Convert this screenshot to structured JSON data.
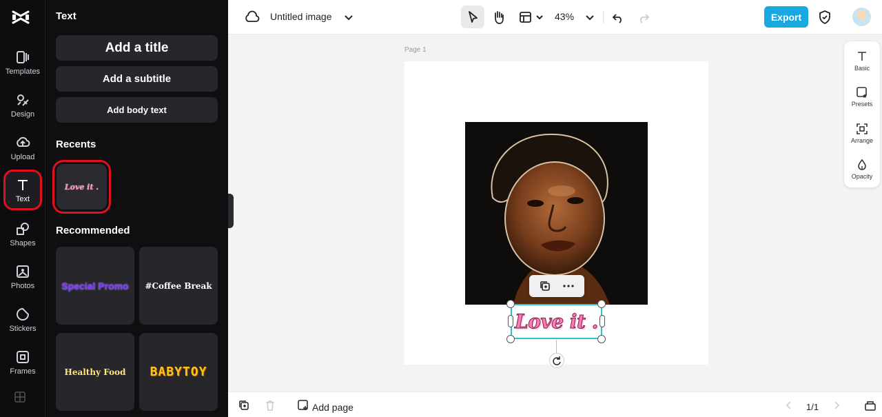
{
  "rail": {
    "items": [
      {
        "label": "Templates",
        "icon": "templates-icon"
      },
      {
        "label": "Design",
        "icon": "design-icon"
      },
      {
        "label": "Upload",
        "icon": "upload-icon"
      },
      {
        "label": "Text",
        "icon": "text-icon",
        "active": true
      },
      {
        "label": "Shapes",
        "icon": "shapes-icon"
      },
      {
        "label": "Photos",
        "icon": "photos-icon"
      },
      {
        "label": "Stickers",
        "icon": "stickers-icon"
      },
      {
        "label": "Frames",
        "icon": "frames-icon"
      }
    ]
  },
  "panel": {
    "title": "Text",
    "add_title": "Add a title",
    "add_subtitle": "Add a subtitle",
    "add_body": "Add body text",
    "recents_title": "Recents",
    "recent_item": "Love it .",
    "recommended_title": "Recommended",
    "recommended": [
      {
        "text": "Special Promo",
        "color": "#7b3cff"
      },
      {
        "text": "#Coffee Break",
        "color": "#ffffff"
      },
      {
        "text": "Healthy Food",
        "color": "#ffe57a"
      },
      {
        "text": "BABYTOY",
        "color": "#ffc21a"
      }
    ]
  },
  "topbar": {
    "doc_title": "Untitled image",
    "zoom": "43%",
    "export_label": "Export",
    "accent_color": "#1aa8e0"
  },
  "canvas": {
    "page_label": "Page 1",
    "text_element": "Love it ."
  },
  "props": {
    "items": [
      {
        "label": "Basic",
        "icon": "basic-text-icon"
      },
      {
        "label": "Presets",
        "icon": "presets-icon"
      },
      {
        "label": "Arrange",
        "icon": "arrange-icon"
      },
      {
        "label": "Opacity",
        "icon": "opacity-icon"
      }
    ]
  },
  "bottombar": {
    "add_page_label": "Add page",
    "page_count": "1/1"
  }
}
